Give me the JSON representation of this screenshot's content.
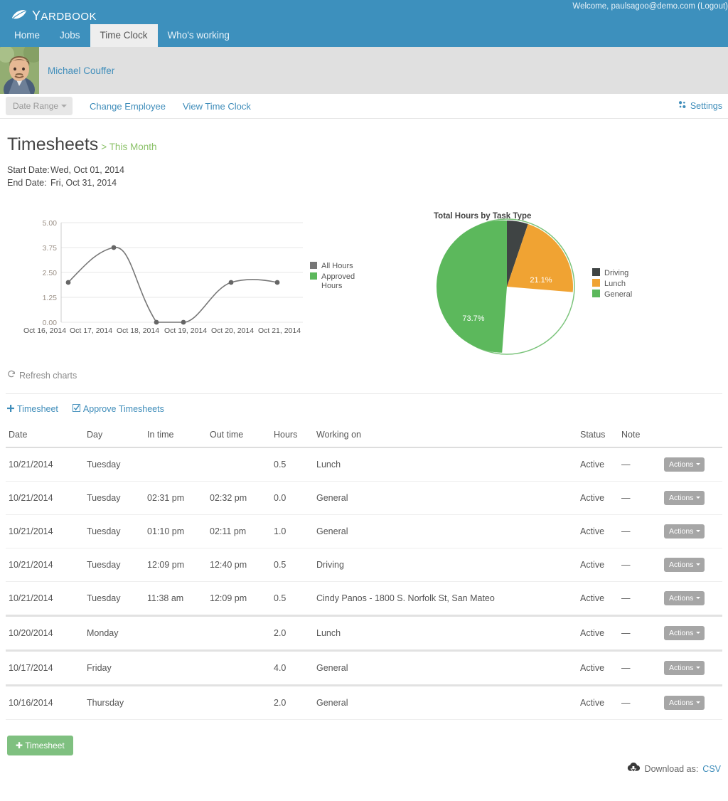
{
  "header": {
    "brand": "Yardbook",
    "brand_icon": "leaf-icon",
    "welcome_text": "Welcome, paulsagoo@demo.com (Logout)",
    "nav": [
      {
        "label": "Home",
        "active": false
      },
      {
        "label": "Jobs",
        "active": false
      },
      {
        "label": "Time Clock",
        "active": true
      },
      {
        "label": "Who's working",
        "active": false
      }
    ]
  },
  "employee": {
    "name": "Michael Couffer",
    "avatar_icon": "user-photo-avatar"
  },
  "toolbar": {
    "date_range_label": "Date Range",
    "change_employee_label": "Change Employee",
    "view_time_clock_label": "View Time Clock",
    "settings_label": "Settings",
    "settings_icon": "gear-icon"
  },
  "page": {
    "title": "Timesheets",
    "breadcrumb": "> This Month",
    "start_date_label": "Start Date:",
    "start_date_value": "Wed, Oct 01, 2014",
    "end_date_label": "End Date:",
    "end_date_value": "Fri, Oct 31, 2014"
  },
  "refresh": {
    "label": "Refresh charts",
    "icon": "refresh-icon"
  },
  "actions": {
    "add_timesheet_label": "Timesheet",
    "add_icon": "plus-icon",
    "approve_label": "Approve Timesheets",
    "approve_icon": "checkbox-icon"
  },
  "table": {
    "columns": [
      "Date",
      "Day",
      "In time",
      "Out time",
      "Hours",
      "Working on",
      "Status",
      "Note",
      ""
    ],
    "actions_button_label": "Actions",
    "rows": [
      {
        "date": "10/21/2014",
        "day": "Tuesday",
        "in_time": "",
        "out_time": "",
        "hours": "0.5",
        "working_on": "Lunch",
        "status": "Active",
        "note": "—",
        "group_end": false
      },
      {
        "date": "10/21/2014",
        "day": "Tuesday",
        "in_time": "02:31 pm",
        "out_time": "02:32 pm",
        "hours": "0.0",
        "working_on": "General",
        "status": "Active",
        "note": "—",
        "group_end": false
      },
      {
        "date": "10/21/2014",
        "day": "Tuesday",
        "in_time": "01:10 pm",
        "out_time": "02:11 pm",
        "hours": "1.0",
        "working_on": "General",
        "status": "Active",
        "note": "—",
        "group_end": false
      },
      {
        "date": "10/21/2014",
        "day": "Tuesday",
        "in_time": "12:09 pm",
        "out_time": "12:40 pm",
        "hours": "0.5",
        "working_on": "Driving",
        "status": "Active",
        "note": "—",
        "group_end": false
      },
      {
        "date": "10/21/2014",
        "day": "Tuesday",
        "in_time": "11:38 am",
        "out_time": "12:09 pm",
        "hours": "0.5",
        "working_on": "Cindy Panos - 1800 S. Norfolk St, San Mateo",
        "status": "Active",
        "note": "—",
        "group_end": true
      },
      {
        "date": "10/20/2014",
        "day": "Monday",
        "in_time": "",
        "out_time": "",
        "hours": "2.0",
        "working_on": "Lunch",
        "status": "Active",
        "note": "—",
        "group_end": true
      },
      {
        "date": "10/17/2014",
        "day": "Friday",
        "in_time": "",
        "out_time": "",
        "hours": "4.0",
        "working_on": "General",
        "status": "Active",
        "note": "—",
        "group_end": true
      },
      {
        "date": "10/16/2014",
        "day": "Thursday",
        "in_time": "",
        "out_time": "",
        "hours": "2.0",
        "working_on": "General",
        "status": "Active",
        "note": "—",
        "group_end": false
      }
    ]
  },
  "footer": {
    "add_timesheet_label": "Timesheet",
    "download_label": "Download as:",
    "download_format": "CSV",
    "download_icon": "cloud-download-icon"
  },
  "colors": {
    "brand_blue": "#3d90bd",
    "link_blue": "#3f8dba",
    "green": "#5cb85c",
    "pie_driving": "#3f4444",
    "pie_lunch": "#f0a333",
    "pie_general": "#5cb85c",
    "line_gray": "#777777",
    "button_gray": "#a6a6a6",
    "add_button_green": "#7fc080"
  },
  "chart_data": [
    {
      "type": "line",
      "title": "",
      "x": [
        "Oct 16, 2014",
        "Oct 17, 2014",
        "Oct 18, 2014",
        "Oct 19, 2014",
        "Oct 20, 2014",
        "Oct 21, 2014"
      ],
      "series": [
        {
          "name": "All Hours",
          "color": "#777777",
          "values": [
            2.0,
            4.0,
            0.0,
            0.0,
            2.0,
            2.0
          ]
        },
        {
          "name": "Approved Hours",
          "color": "#5cb85c",
          "values": [
            0,
            0,
            0,
            0,
            0,
            0
          ]
        }
      ],
      "ylim": [
        0,
        5
      ],
      "yticks": [
        "0.00",
        "1.25",
        "2.50",
        "3.75",
        "5.00"
      ],
      "xlabel": "",
      "ylabel": "",
      "grid": true,
      "legend_position": "right",
      "legend": [
        "All Hours",
        "Approved Hours"
      ]
    },
    {
      "type": "pie",
      "title": "Total Hours by Task Type",
      "labels": [
        "Driving",
        "Lunch",
        "General"
      ],
      "values": [
        5.2,
        21.1,
        73.7
      ],
      "value_labels": [
        "",
        "21.1%",
        "73.7%"
      ],
      "colors": [
        "#3f4444",
        "#f0a333",
        "#5cb85c"
      ],
      "legend_position": "right"
    }
  ]
}
